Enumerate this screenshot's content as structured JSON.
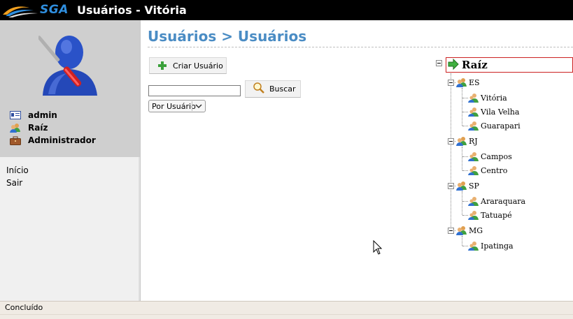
{
  "header": {
    "logo_text": "SGA",
    "title": "Usuários - Vitória"
  },
  "sidebar": {
    "user": {
      "name": "admin",
      "unit": "Raíz",
      "role": "Administrador"
    },
    "menu": [
      {
        "label": "Início"
      },
      {
        "label": "Sair"
      }
    ]
  },
  "main": {
    "title": "Usuários > Usuários",
    "create_button": "Criar Usuário",
    "search_input_value": "",
    "search_button": "Buscar",
    "filter_select": "Por Usuário"
  },
  "tree": {
    "root": "Raíz",
    "groups": [
      {
        "label": "ES",
        "children": [
          "Vitória",
          "Vila Velha",
          "Guarapari"
        ]
      },
      {
        "label": "RJ",
        "children": [
          "Campos",
          "Centro"
        ]
      },
      {
        "label": "SP",
        "children": [
          "Araraquara",
          "Tatuapé"
        ]
      },
      {
        "label": "MG",
        "children": [
          "Ipatinga"
        ]
      }
    ]
  },
  "statusbar": {
    "text": "Concluído"
  },
  "colors": {
    "title_blue": "#4a8cc4",
    "header_bg": "#000000",
    "root_border": "#cc2222"
  }
}
